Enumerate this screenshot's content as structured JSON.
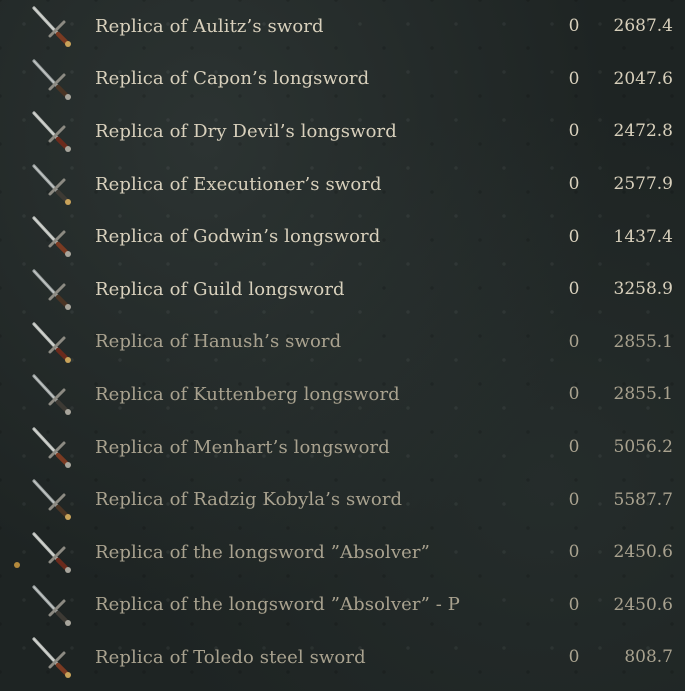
{
  "items": [
    {
      "name": "Replica of Aulitz’s sword",
      "qty": "0",
      "value": "2687.4",
      "icon": "sword-icon",
      "dim": false
    },
    {
      "name": "Replica of Capon’s longsword",
      "qty": "0",
      "value": "2047.6",
      "icon": "sword-icon",
      "dim": false
    },
    {
      "name": "Replica of Dry Devil’s longsword",
      "qty": "0",
      "value": "2472.8",
      "icon": "sword-icon",
      "dim": false
    },
    {
      "name": "Replica of Executioner’s sword",
      "qty": "0",
      "value": "2577.9",
      "icon": "sword-icon",
      "dim": false
    },
    {
      "name": "Replica of Godwin’s longsword",
      "qty": "0",
      "value": "1437.4",
      "icon": "sword-icon",
      "dim": false
    },
    {
      "name": "Replica of Guild longsword",
      "qty": "0",
      "value": "3258.9",
      "icon": "sword-icon",
      "dim": false
    },
    {
      "name": "Replica of Hanush’s sword",
      "qty": "0",
      "value": "2855.1",
      "icon": "sword-icon",
      "dim": true
    },
    {
      "name": "Replica of Kuttenberg longsword",
      "qty": "0",
      "value": "2855.1",
      "icon": "sword-icon",
      "dim": true
    },
    {
      "name": "Replica of Menhart’s longsword",
      "qty": "0",
      "value": "5056.2",
      "icon": "sword-icon",
      "dim": true
    },
    {
      "name": "Replica of Radzig Kobyla’s sword",
      "qty": "0",
      "value": "5587.7",
      "icon": "sword-icon",
      "dim": true
    },
    {
      "name": "Replica of the longsword ”Absolver”",
      "qty": "0",
      "value": "2450.6",
      "icon": "sword-icon",
      "dim": true
    },
    {
      "name": "Replica of the longsword ”Absolver” - P",
      "qty": "0",
      "value": "2450.6",
      "icon": "sword-icon",
      "dim": true
    },
    {
      "name": "Replica of Toledo steel sword",
      "qty": "0",
      "value": "808.7",
      "icon": "sword-icon",
      "dim": true
    }
  ],
  "colors": {
    "text": "#d8d0bc",
    "text_dim": "#a9a28f",
    "accent": "#b48a3c"
  }
}
